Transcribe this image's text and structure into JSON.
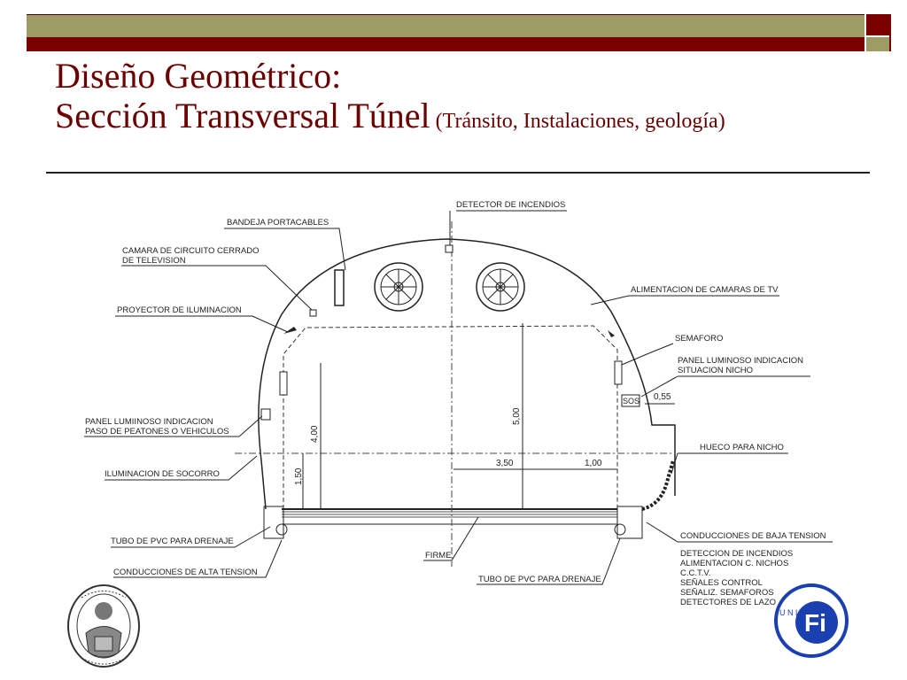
{
  "slide": {
    "title_line1": "Diseño Geométrico:",
    "title_line2": "Sección Transversal Túnel",
    "title_sub": "(Tránsito, Instalaciones, geología)"
  },
  "diagram": {
    "labels": {
      "detector_incendios": "DETECTOR DE INCENDIOS",
      "bandeja": "BANDEJA PORTACABLES",
      "camara_l1": "CAMARA DE CIRCUITO CERRADO",
      "camara_l2": "DE TELEVISION",
      "proyector": "PROYECTOR DE ILUMINACION",
      "alimentacion_tv": "ALIMENTACION DE CAMARAS DE TV",
      "semaforo": "SEMAFORO",
      "panel_nicho_l1": "PANEL LUMINOSO INDICACION",
      "panel_nicho_l2": "SITUACION NICHO",
      "sos": "SOS",
      "panel_peatones_l1": "PANEL LUMIINOSO INDICACION",
      "panel_peatones_l2": "PASO DE PEATONES O VEHICULOS",
      "hueco_nicho": "HUECO PARA NICHO",
      "iluminacion_socorro": "ILUMINACION DE SOCORRO",
      "tubo_pvc_izq": "TUBO DE PVC PARA DRENAJE",
      "alta_tension": "CONDUCCIONES DE ALTA TENSION",
      "firme": "FIRME",
      "tubo_pvc_der": "TUBO DE PVC PARA DRENAJE",
      "baja_tension": "CONDUCCIONES DE BAJA TENSION",
      "list1": "DETECCION DE INCENDIOS",
      "list2": "ALIMENTACION C. NICHOS",
      "list3": "C.C.T.V.",
      "list4": "SEÑALES CONTROL",
      "list5": "SEÑALIZ. SEMAFOROS",
      "list6": "DETECTORES DE LAZO"
    },
    "dimensions": {
      "d400": "4,00",
      "d150": "1,50",
      "d500": "5,00",
      "d350": "3,50",
      "d100": "1,00",
      "d055": "0,55"
    }
  },
  "logos": {
    "left": "university-seal",
    "right_letters": "Fi",
    "right_ring": "U N L P"
  },
  "colors": {
    "olive": "#9c9c64",
    "maroon": "#7a0000",
    "title": "#6b0000",
    "logo_blue": "#1a3fb0"
  }
}
